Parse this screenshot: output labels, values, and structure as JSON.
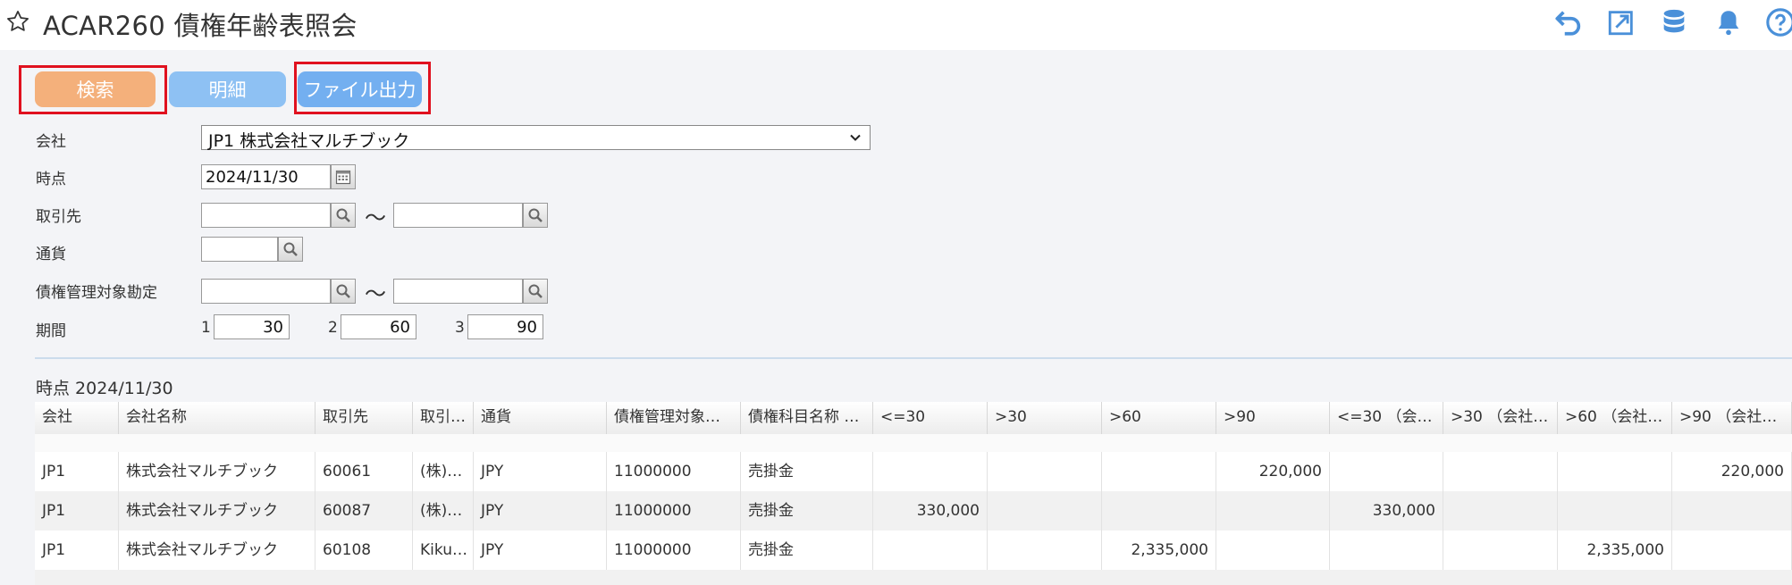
{
  "header": {
    "title": "ACAR260 債権年齢表照会",
    "icons": [
      "star-icon",
      "undo-icon",
      "export-icon",
      "database-icon",
      "bell-icon",
      "help-icon"
    ]
  },
  "toolbar": {
    "search_label": "検索",
    "detail_label": "明細",
    "file_output_label": "ファイル出力"
  },
  "form": {
    "company": {
      "label": "会社",
      "value": "JP1 株式会社マルチブック"
    },
    "as_of": {
      "label": "時点",
      "value": "2024/11/30"
    },
    "partner": {
      "label": "取引先",
      "from": "",
      "to": "",
      "range_sep": "〜"
    },
    "currency": {
      "label": "通貨",
      "value": ""
    },
    "account": {
      "label": "債権管理対象勘定",
      "from": "",
      "to": "",
      "range_sep": "〜"
    },
    "periods": {
      "label": "期間",
      "items": [
        {
          "index": "1",
          "value": "30"
        },
        {
          "index": "2",
          "value": "60"
        },
        {
          "index": "3",
          "value": "90"
        }
      ]
    }
  },
  "results": {
    "section_title": "時点 2024/11/30",
    "columns": [
      "会社",
      "会社名称",
      "取引先",
      "取引…",
      "通貨",
      "債権管理対象…",
      "債権科目名称 …",
      "<=30",
      ">30",
      ">60",
      ">90",
      "<=30 （会…",
      ">30 （会社…",
      ">60 （会社…",
      ">90 （会社…"
    ],
    "rows": [
      [
        "JP1",
        "株式会社マルチブック",
        "60061",
        "(株)…",
        "JPY",
        "11000000",
        "売掛金",
        "",
        "",
        "",
        "220,000",
        "",
        "",
        "",
        "220,000"
      ],
      [
        "JP1",
        "株式会社マルチブック",
        "60087",
        "(株)…",
        "JPY",
        "11000000",
        "売掛金",
        "330,000",
        "",
        "",
        "",
        "330,000",
        "",
        "",
        ""
      ],
      [
        "JP1",
        "株式会社マルチブック",
        "60108",
        "Kiku…",
        "JPY",
        "11000000",
        "売掛金",
        "",
        "",
        "2,335,000",
        "",
        "",
        "",
        "2,335,000",
        ""
      ]
    ]
  },
  "colors": {
    "search_button": "#f4b07b",
    "detail_button": "#8ec1f3",
    "file_button": "#73aff0",
    "highlight_border": "#e0111f",
    "header_icon": "#4a90d9"
  }
}
